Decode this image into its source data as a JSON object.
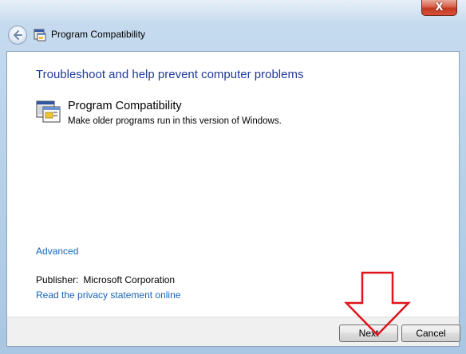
{
  "window": {
    "title": "Program Compatibility",
    "close_label": "X"
  },
  "content": {
    "heading": "Troubleshoot and help prevent computer problems",
    "program_title": "Program Compatibility",
    "program_description": "Make older programs run in this version of Windows.",
    "advanced_link": "Advanced",
    "publisher_label": "Publisher:",
    "publisher_value": "Microsoft Corporation",
    "privacy_link": "Read the privacy statement online"
  },
  "buttons": {
    "next_label": "Next",
    "cancel_label": "Cancel"
  },
  "colors": {
    "heading": "#1e3b9a",
    "link": "#1764b6",
    "annotation_arrow": "#e0141c"
  },
  "icons": {
    "back": "back-arrow-icon",
    "title": "program-compatibility-icon",
    "program": "program-compatibility-icon",
    "annotation": "red-down-arrow-icon"
  }
}
